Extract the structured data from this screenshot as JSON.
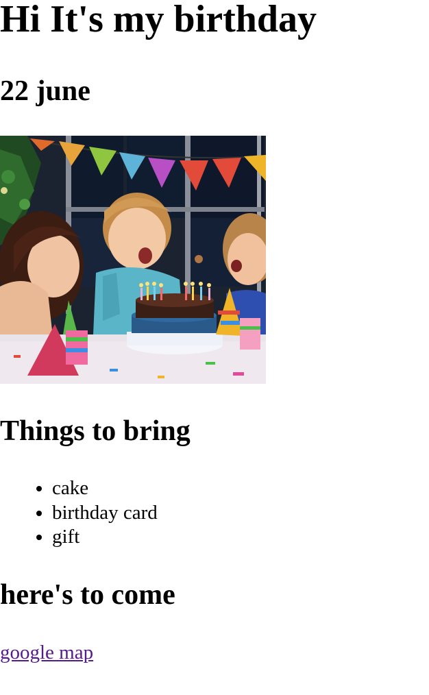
{
  "page": {
    "title": "Hi It's my birthday",
    "date": "22 june"
  },
  "photo": {
    "alt": "Children blowing out candles on a birthday cake"
  },
  "bring": {
    "heading": "Things to bring",
    "items": [
      {
        "label": "cake"
      },
      {
        "label": "birthday card"
      },
      {
        "label": "gift"
      }
    ]
  },
  "location": {
    "heading": "here's to come",
    "link_label": "google map"
  },
  "colors": {
    "link_visited": "#551a8b",
    "text": "#000000"
  }
}
